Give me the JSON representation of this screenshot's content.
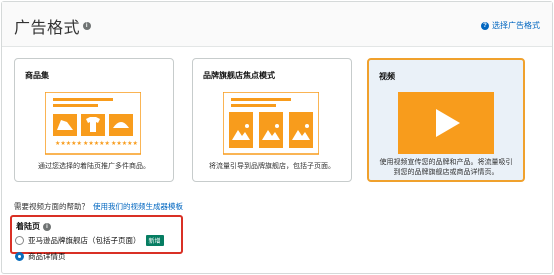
{
  "header": {
    "title": "广告格式",
    "help_link": "选择广告格式"
  },
  "cards": [
    {
      "title": "商品集",
      "description": "通过您选择的着陆页推广多件商品。"
    },
    {
      "title": "品牌旗舰店焦点模式",
      "description": "将流量引导到品牌旗舰店，包括子页面。"
    },
    {
      "title": "视频",
      "description": "使用视频宣传您的品牌和产品。将流量吸引到您的品牌旗舰店或商品详情页。",
      "selected": true
    }
  ],
  "video_help": {
    "question": "需要视频方面的帮助？",
    "link": "使用我们的视频生成器模板"
  },
  "landing_page": {
    "title": "着陆页",
    "options": [
      {
        "label": "亚马逊品牌旗舰店（包括子页面）",
        "badge": "新增",
        "checked": false
      },
      {
        "label": "商品详情页",
        "checked": true
      }
    ]
  },
  "colors": {
    "accent_orange": "#f89c1c",
    "link_blue": "#0066c0",
    "badge_green": "#067d62",
    "highlight_red": "#d93025"
  }
}
